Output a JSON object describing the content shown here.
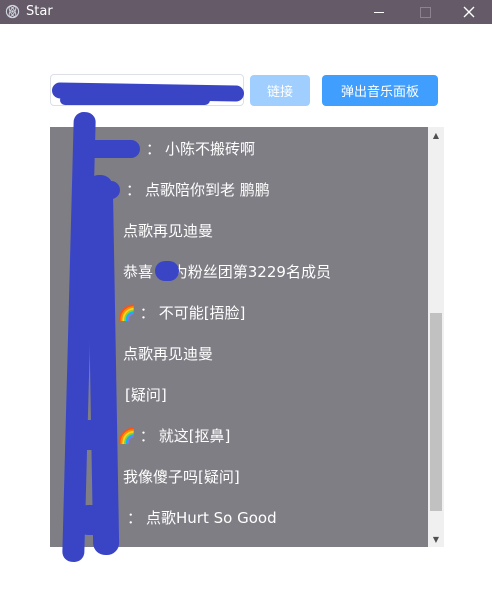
{
  "window": {
    "title": "Star",
    "controls": {
      "minimize": "minimize",
      "maximize": "maximize",
      "close": "×"
    }
  },
  "toolbar": {
    "room_input_value": "",
    "link_label": "链接",
    "music_panel_label": "弹出音乐面板"
  },
  "chat": {
    "messages": [
      {
        "user": "",
        "sep": "：",
        "text": "小陈不搬砖啊"
      },
      {
        "user": "",
        "sep": "：",
        "text": "点歌陪你到老 鹏鹏"
      },
      {
        "user": "",
        "sep": "",
        "text": "点歌再见迪曼"
      },
      {
        "user": "",
        "sep": "",
        "text": "恭喜 成为粉丝团第3229名成员"
      },
      {
        "user": "🌈",
        "sep": "：",
        "text": "不可能[捂脸]"
      },
      {
        "user": "",
        "sep": "",
        "text": "点歌再见迪曼"
      },
      {
        "user": "",
        "sep": "：",
        "text": "[疑问]"
      },
      {
        "user": "🌈",
        "sep": "：",
        "text": "就这[抠鼻]"
      },
      {
        "user": "",
        "sep": "",
        "text": "我像傻子吗[疑问]"
      },
      {
        "user": "",
        "sep": "：",
        "text": "点歌Hurt So Good"
      }
    ]
  },
  "colors": {
    "titlebar": "#655a68",
    "chat_bg": "#7f7e84",
    "primary_button": "#409eff",
    "disabled_button": "#a0cfff",
    "redaction": "#3a45c6"
  },
  "scrollbar": {
    "up_icon": "▲",
    "down_icon": "▼"
  }
}
